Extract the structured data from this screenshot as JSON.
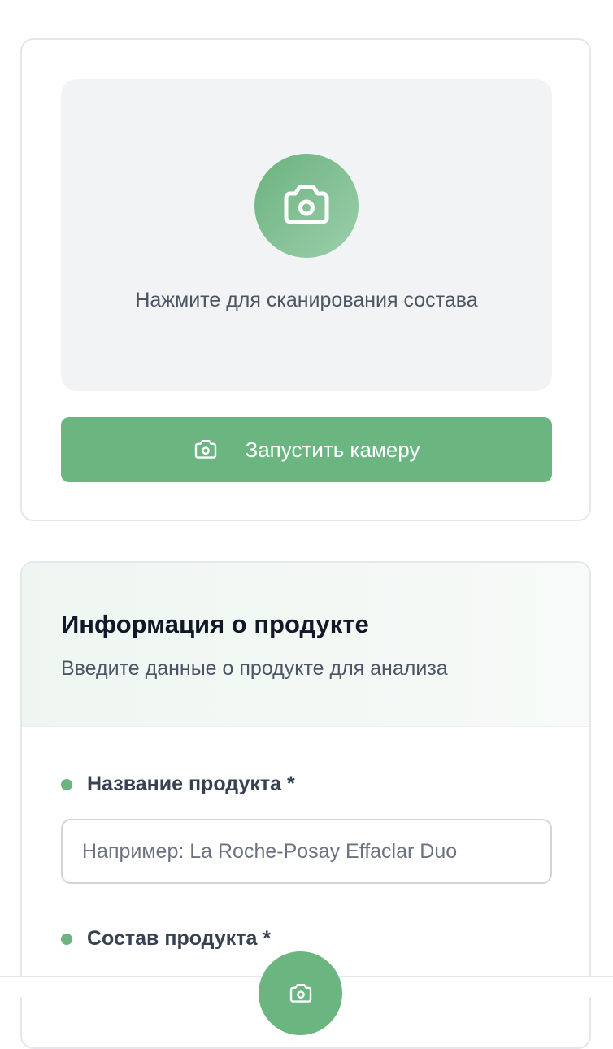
{
  "scanner": {
    "hint": "Нажмите для сканирования состава",
    "start_camera_label": "Запустить камеру"
  },
  "product_info": {
    "title": "Информация о продукте",
    "subtitle": "Введите данные о продукте для анализа",
    "name_label": "Название продукта *",
    "name_placeholder": "Например: La Roche-Posay Effaclar Duo",
    "composition_label": "Состав продукта *"
  },
  "colors": {
    "accent": "#6ab580"
  }
}
